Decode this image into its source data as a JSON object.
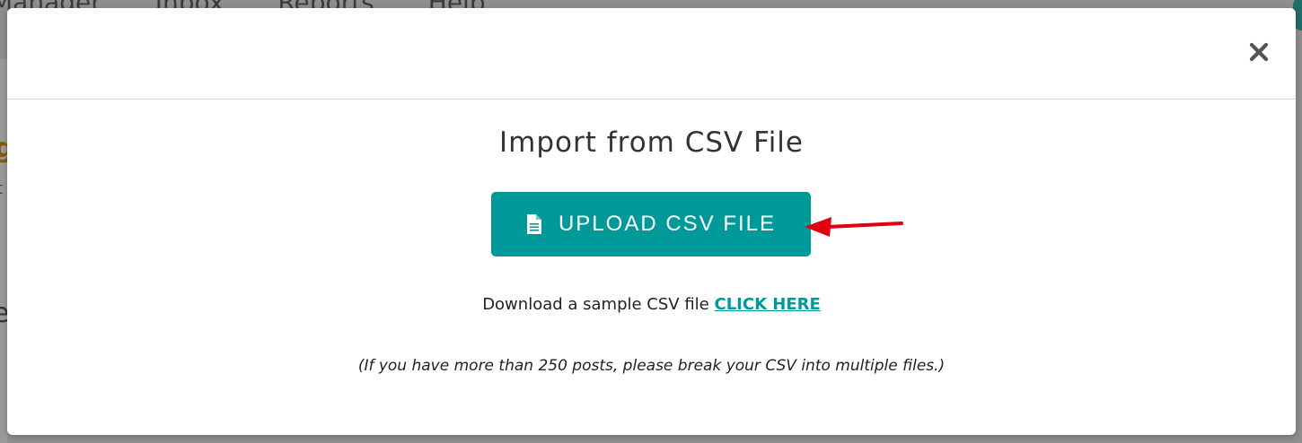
{
  "background": {
    "nav_items": [
      "Manager",
      "Inbox",
      "Reports",
      "Help"
    ]
  },
  "modal": {
    "title": "Import from CSV File",
    "close_icon": "close-icon",
    "upload_button": {
      "icon": "file-icon",
      "label": "UPLOAD CSV FILE"
    },
    "sample": {
      "text": "Download a sample CSV file",
      "link_label": "CLICK HERE"
    },
    "note": "(If you have more than 250 posts, please break your CSV into multiple files.)"
  },
  "colors": {
    "accent": "#00999a",
    "annotation_arrow": "#e0000f",
    "title_text": "#333333"
  }
}
